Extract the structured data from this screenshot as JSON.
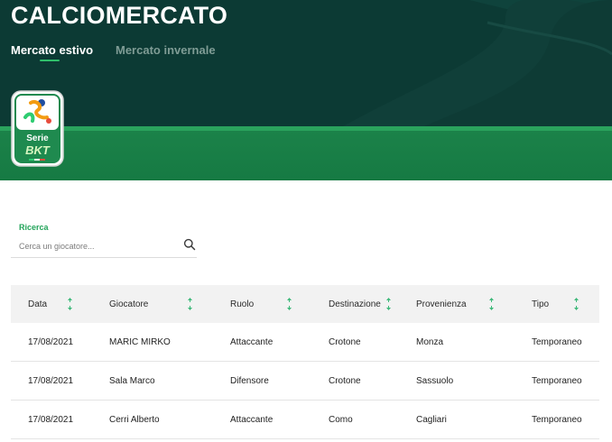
{
  "header": {
    "title": "CALCIOMERCATO",
    "tabs": [
      {
        "label": "Mercato estivo",
        "active": true
      },
      {
        "label": "Mercato invernale",
        "active": false
      }
    ],
    "logo": {
      "line1": "Serie",
      "line2": "BKT"
    }
  },
  "search": {
    "label": "Ricerca",
    "placeholder": "Cerca un giocatore..."
  },
  "table": {
    "columns": [
      "Data",
      "Giocatore",
      "Ruolo",
      "Destinazione",
      "Provenienza",
      "Tipo"
    ],
    "rows": [
      [
        "17/08/2021",
        "MARIC MIRKO",
        "Attaccante",
        "Crotone",
        "Monza",
        "Temporaneo"
      ],
      [
        "17/08/2021",
        "Sala Marco",
        "Difensore",
        "Crotone",
        "Sassuolo",
        "Temporaneo"
      ],
      [
        "17/08/2021",
        "Cerri Alberto",
        "Attaccante",
        "Como",
        "Cagliari",
        "Temporaneo"
      ]
    ]
  },
  "colors": {
    "header_bg": "#0c3a34",
    "stripe": "#167a43",
    "accent": "#23a45a",
    "sort_arrows": "#3fb97a"
  },
  "icons": {
    "search": "search-icon",
    "sort": "sort-arrows-icon"
  }
}
